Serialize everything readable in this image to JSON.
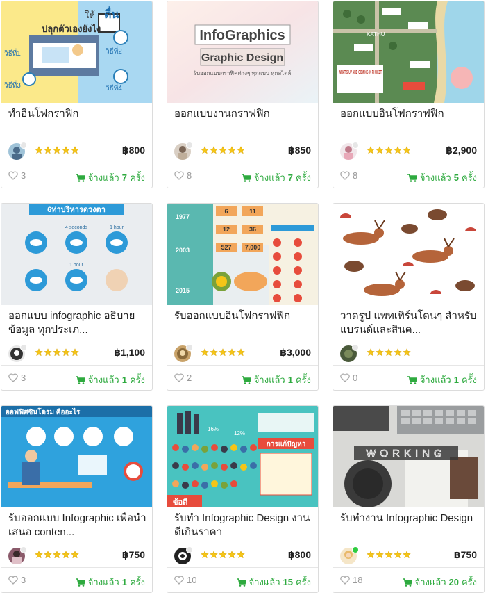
{
  "currency_symbol": "฿",
  "colors": {
    "star": "#f5c518",
    "hired": "#2eaa3f",
    "like": "#999999",
    "online": "#2ecc40"
  },
  "icons": {
    "rating": "star-icon",
    "likes": "heart-icon",
    "hired": "cart-icon"
  },
  "cards": [
    {
      "title": "ทำอินโฟกราฟิก",
      "price": "฿800",
      "likes": "3",
      "hired_prefix": "จ้างแล้ว",
      "hired_count": "7",
      "hired_suffix": "ครั้ง",
      "rating": 5,
      "online": false,
      "thumb": {
        "text_1": "ปลุกตัวเองยังไง",
        "text_2": "ให้",
        "text_3": "ตื่น",
        "text_4": "วิธีที่1",
        "text_5": "วิธีที่2",
        "text_6": "วิธีที่3",
        "text_7": "วิธีที่4"
      }
    },
    {
      "title": "ออกแบบงานกราฟฟิก",
      "price": "฿850",
      "likes": "8",
      "hired_prefix": "จ้างแล้ว",
      "hired_count": "7",
      "hired_suffix": "ครั้ง",
      "rating": 5,
      "online": false,
      "thumb": {
        "text_1": "InfoGraphics",
        "text_2": "Graphic Design",
        "text_3": "รับออกแบบกราฟิคต่างๆ ทุกแบบ ทุกสไตล์"
      }
    },
    {
      "title": "ออกแบบอินโฟกราฟฟิก",
      "price": "฿2,900",
      "likes": "8",
      "hired_prefix": "จ้างแล้ว",
      "hired_count": "5",
      "hired_suffix": "ครั้ง",
      "rating": 5,
      "online": false,
      "thumb": {
        "text_1": "KATHU",
        "text_2": "WHAT'S UP AND COMING IN PHUKET"
      }
    },
    {
      "title": "ออกแบบ infographic อธิบายข้อมูล ทุกประเภ...",
      "price": "฿1,100",
      "likes": "3",
      "hired_prefix": "จ้างแล้ว",
      "hired_count": "1",
      "hired_suffix": "ครั้ง",
      "rating": 5,
      "online": false,
      "thumb": {
        "text_1": "6ท่าบริหารดวงตา",
        "text_2": "4 seconds",
        "text_3": "1 hour",
        "text_4": "1 hour"
      }
    },
    {
      "title": "รับออกแบบอินโฟกราฟฟิก",
      "price": "฿3,000",
      "likes": "2",
      "hired_prefix": "จ้างแล้ว",
      "hired_count": "1",
      "hired_suffix": "ครั้ง",
      "rating": 5,
      "online": false,
      "thumb": {
        "text_1": "1977",
        "text_2": "2003",
        "text_3": "2015",
        "text_4": "6",
        "text_5": "11",
        "text_6": "12",
        "text_7": "36",
        "text_8": "527",
        "text_9": "7,000"
      }
    },
    {
      "title": "วาดรูป แพทเทิร์นโดนๆ สำหรับแบรนด์และสินค...",
      "price": "",
      "likes": "0",
      "hired_prefix": "จ้างแล้ว",
      "hired_count": "1",
      "hired_suffix": "ครั้ง",
      "rating": 5,
      "online": false,
      "thumb": {}
    },
    {
      "title": "รับออกแบบ Infographic เพื่อนำเสนอ conten...",
      "price": "฿750",
      "likes": "3",
      "hired_prefix": "จ้างแล้ว",
      "hired_count": "1",
      "hired_suffix": "ครั้ง",
      "rating": 5,
      "online": false,
      "thumb": {
        "text_1": "ออฟฟิศซินโดรม คืออะไร"
      }
    },
    {
      "title": "รับทำ Infographic Design งานดีเกินราคา",
      "price": "฿800",
      "likes": "10",
      "hired_prefix": "จ้างแล้ว",
      "hired_count": "15",
      "hired_suffix": "ครั้ง",
      "rating": 5,
      "online": false,
      "thumb": {
        "text_1": "16%",
        "text_2": "12%",
        "text_3": "การแก้ปัญหา",
        "text_4": "ข้อดี"
      }
    },
    {
      "title": "รับทำงาน Infographic Design",
      "price": "฿750",
      "likes": "18",
      "hired_prefix": "จ้างแล้ว",
      "hired_count": "20",
      "hired_suffix": "ครั้ง",
      "rating": 5,
      "online": true,
      "thumb": {
        "text_1": "WORKING"
      }
    }
  ]
}
